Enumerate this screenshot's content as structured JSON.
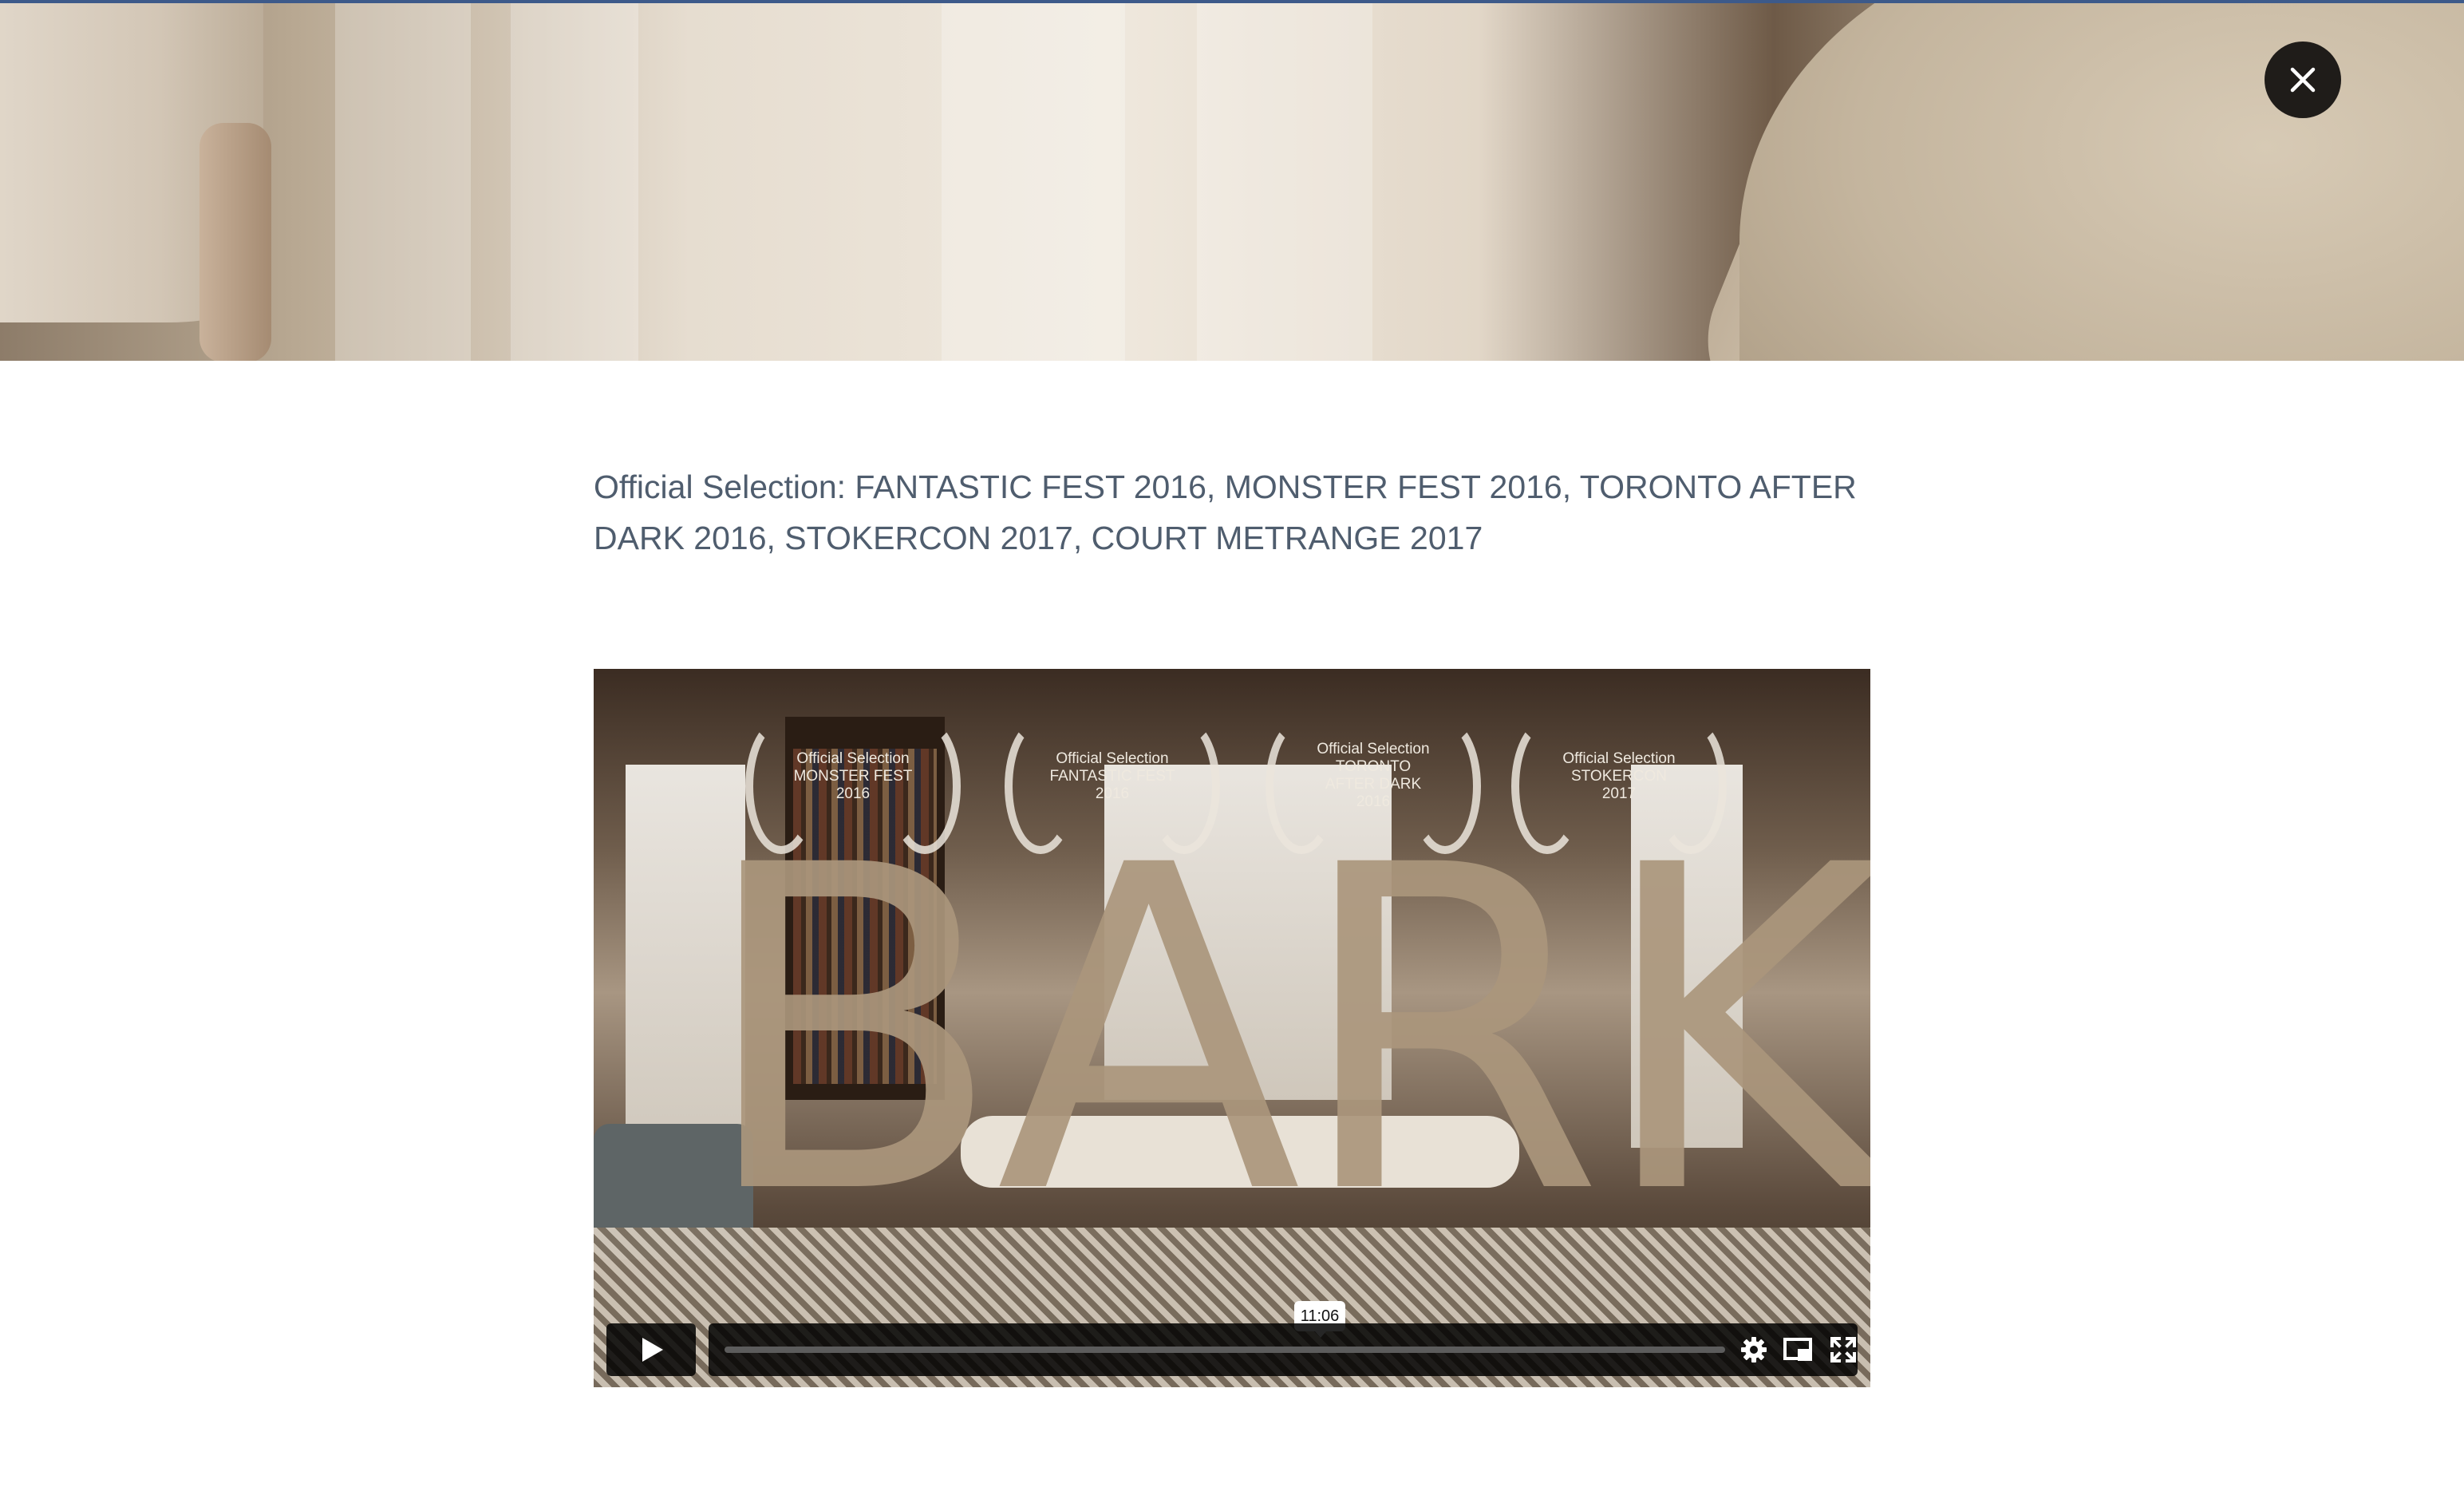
{
  "modal": {
    "close_label": "close-icon"
  },
  "content": {
    "selection_text": "Official Selection: FANTASTIC FEST 2016, MONSTER FEST 2016, TORONTO AFTER DARK 2016, STOKERCON 2017, COURT METRANGE 2017"
  },
  "video": {
    "title_overlay": "BARK",
    "laurels": [
      "Official Selection\nMONSTER FEST\n2016",
      "Official Selection\nFANTASTIC FEST\n2016",
      "Official Selection\nTORONTO\nAFTER DARK\n2016",
      "Official Selection\nSTOKERCON\n2017"
    ],
    "duration_tooltip": "11:06",
    "progress": 0,
    "icons": [
      "play-icon",
      "settings-icon",
      "picture-in-picture-icon",
      "fullscreen-icon"
    ]
  },
  "colors": {
    "accent_top_line": "#3d5a8a",
    "body_text": "#4f5d6e",
    "controls_bg": "#000000"
  }
}
